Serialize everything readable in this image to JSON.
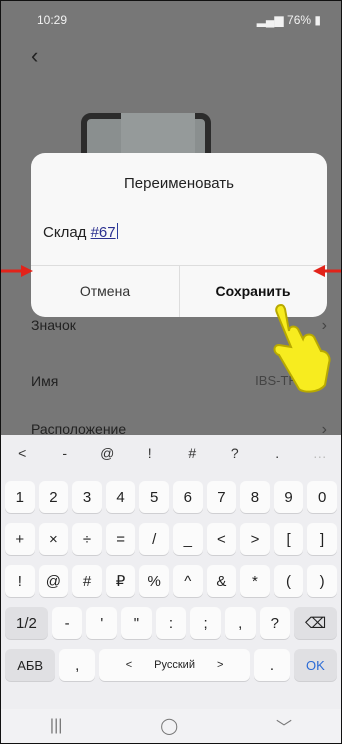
{
  "status_bar": {
    "time": "10:29",
    "battery": "76%"
  },
  "screen": {
    "rows": [
      {
        "label": "Значок",
        "value": ""
      },
      {
        "label": "Имя",
        "value": "IBS-TH3"
      },
      {
        "label": "Расположение",
        "value": ""
      }
    ]
  },
  "dialog": {
    "title": "Переименовать",
    "input_value_prefix": "Склад ",
    "input_value_number": "#67",
    "cancel_label": "Отмена",
    "save_label": "Сохранить"
  },
  "keyboard": {
    "suggestions": [
      "<",
      "-",
      "@",
      "!",
      "#",
      "?",
      ".",
      "…"
    ],
    "row1": [
      "1",
      "2",
      "3",
      "4",
      "5",
      "6",
      "7",
      "8",
      "9",
      "0"
    ],
    "row2": [
      "+",
      "×",
      "÷",
      "=",
      "/",
      "_",
      "<",
      ">",
      "[",
      "]"
    ],
    "row3": [
      "!",
      "@",
      "#",
      "₽",
      "%",
      "^",
      "&",
      "*",
      "(",
      ")"
    ],
    "row4": [
      "1/2",
      "-",
      "'",
      "\"",
      ":",
      ";",
      ",",
      "?"
    ],
    "row5": {
      "abc": "АБВ",
      "comma": ",",
      "left": "<",
      "lang": "Русский",
      "right": ">",
      "dot": ".",
      "ok": "OK"
    }
  },
  "nav": {
    "recents": "|||",
    "home": "◯",
    "back": "﹀"
  },
  "colors": {
    "accent": "#2b6bd6",
    "arrow": "#e2231a",
    "hand": "#f7ec1f"
  }
}
